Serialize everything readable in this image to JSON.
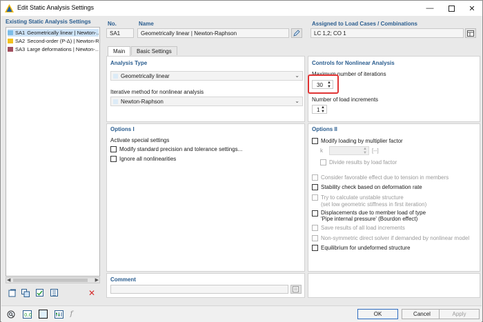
{
  "window": {
    "title": "Edit Static Analysis Settings"
  },
  "left_panel": {
    "header": "Existing Static Analysis Settings",
    "items": [
      {
        "code": "SA1",
        "label": "Geometrically linear | Newton-...",
        "color": "#7dbde7",
        "selected": true
      },
      {
        "code": "SA2",
        "label": "Second-order (P-Δ) | Newton-R",
        "color": "#f2c11d"
      },
      {
        "code": "SA3",
        "label": "Large deformations | Newton-...",
        "color": "#a24f5f"
      }
    ]
  },
  "header": {
    "no_label": "No.",
    "no_value": "SA1",
    "name_label": "Name",
    "name_value": "Geometrically linear | Newton-Raphson",
    "assigned_label": "Assigned to Load Cases / Combinations",
    "assigned_value": "LC 1,2; CO 1"
  },
  "tabs": [
    {
      "label": "Main",
      "active": true
    },
    {
      "label": "Basic Settings",
      "active": false
    }
  ],
  "analysis_type": {
    "title": "Analysis Type",
    "type_value": "Geometrically linear",
    "method_label": "Iterative method for nonlinear analysis",
    "method_value": "Newton-Raphson"
  },
  "controls": {
    "title": "Controls for Nonlinear Analysis",
    "iterations_label": "Maximum number of iterations",
    "iterations_value": "30",
    "increments_label": "Number of load increments",
    "increments_value": "1"
  },
  "options1": {
    "title": "Options I",
    "activate_label": "Activate special settings",
    "items": [
      "Modify standard precision and tolerance settings...",
      "Ignore all nonlinearities"
    ]
  },
  "options2": {
    "title": "Options II",
    "modify_loading": "Modify loading by multiplier factor",
    "k_label": "k",
    "k_unit": "[--]",
    "divide_results": "Divide results by load factor",
    "favorable": "Consider favorable effect due to tension in members",
    "stability": "Stability check based on deformation rate",
    "unstable_1": "Try to calculate unstable structure",
    "unstable_2": "(set low geometric stiffness in first iteration)",
    "displacements_1": "Displacements due to member load of type",
    "displacements_2": "'Pipe internal pressure' (Bourdon effect)",
    "save_results": "Save results of all load increments",
    "nonsymmetric": "Non-symmetric direct solver if demanded by nonlinear model",
    "equilibrium": "Equilibrium for undeformed structure"
  },
  "comment": {
    "label": "Comment"
  },
  "buttons": {
    "ok": "OK",
    "cancel": "Cancel",
    "apply": "Apply"
  },
  "colors": {
    "accent": "#2a5d8f",
    "highlight": "#e03434",
    "delete": "#d62b2b"
  }
}
